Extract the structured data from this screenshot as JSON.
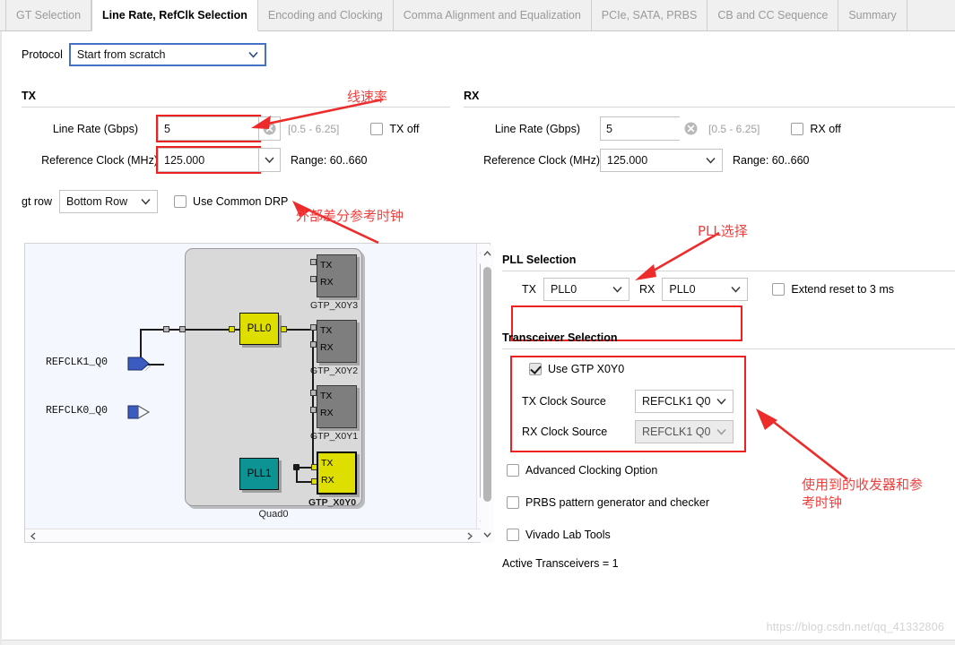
{
  "tabs": [
    {
      "label": "GT Selection",
      "active": false
    },
    {
      "label": "Line Rate, RefClk Selection",
      "active": true
    },
    {
      "label": "Encoding and Clocking",
      "active": false
    },
    {
      "label": "Comma Alignment and Equalization",
      "active": false
    },
    {
      "label": "PCIe, SATA, PRBS",
      "active": false
    },
    {
      "label": "CB and CC Sequence",
      "active": false
    },
    {
      "label": "Summary",
      "active": false
    }
  ],
  "protocol": {
    "label": "Protocol",
    "value": "Start from scratch"
  },
  "tx": {
    "title": "TX",
    "line_rate_label": "Line Rate (Gbps)",
    "line_rate_value": "5",
    "line_rate_range": "[0.5 - 6.25]",
    "off_label": "TX off",
    "off_checked": false,
    "refclk_label": "Reference Clock (MHz)",
    "refclk_value": "125.000",
    "refclk_range": "Range: 60..660"
  },
  "rx": {
    "title": "RX",
    "line_rate_label": "Line Rate (Gbps)",
    "line_rate_value": "5",
    "line_rate_range": "[0.5 - 6.25]",
    "off_label": "RX off",
    "off_checked": false,
    "refclk_label": "Reference Clock (MHz)",
    "refclk_value": "125.000",
    "refclk_range": "Range: 60..660"
  },
  "gtrow": {
    "label": "gt row",
    "value": "Bottom Row",
    "common_drp_label": "Use Common DRP",
    "common_drp_checked": false
  },
  "pll_selection": {
    "title": "PLL Selection",
    "tx_label": "TX",
    "tx_value": "PLL0",
    "rx_label": "RX",
    "rx_value": "PLL0",
    "extend_reset_label": "Extend reset to 3 ms",
    "extend_reset_checked": false
  },
  "transceiver_selection": {
    "title": "Transceiver Selection",
    "use_gtp_label": "Use GTP X0Y0",
    "use_gtp_checked": true,
    "tx_clock_source_label": "TX Clock Source",
    "tx_clock_source_value": "REFCLK1 Q0",
    "rx_clock_source_label": "RX Clock Source",
    "rx_clock_source_value": "REFCLK1 Q0",
    "advanced_clocking_label": "Advanced Clocking Option",
    "advanced_clocking_checked": false,
    "prbs_label": "PRBS pattern generator and checker",
    "prbs_checked": false,
    "vivado_lab_label": "Vivado Lab Tools",
    "vivado_lab_checked": false,
    "active_transceivers": "Active Transceivers = 1"
  },
  "diagram": {
    "quad_label": "Quad0",
    "refclk1": "REFCLK1_Q0",
    "refclk0": "REFCLK0_Q0",
    "pll0": "PLL0",
    "pll1": "PLL1",
    "tx_port": "TX",
    "rx_port": "RX",
    "gtp3": "GTP_X0Y3",
    "gtp2": "GTP_X0Y2",
    "gtp1": "GTP_X0Y1",
    "gtp0": "GTP_X0Y0"
  },
  "annotations": {
    "line_rate": "线速率",
    "ext_diff_refclk": "外部差分参考时钟",
    "pll_select": "PLL选择",
    "used_transceiver": "使用到的收发器和参\n考时钟"
  },
  "watermark": "https://blog.csdn.net/qq_41332806",
  "colors": {
    "accent_blue": "#4472c4",
    "annotation_red": "#f0413f",
    "highlight_red": "#ef2020",
    "pll0_yellow": "#dede00",
    "pll1_teal": "#0d9393",
    "gtp_gray": "#7e7e7e",
    "refclk_blue": "#3b5bc0"
  }
}
